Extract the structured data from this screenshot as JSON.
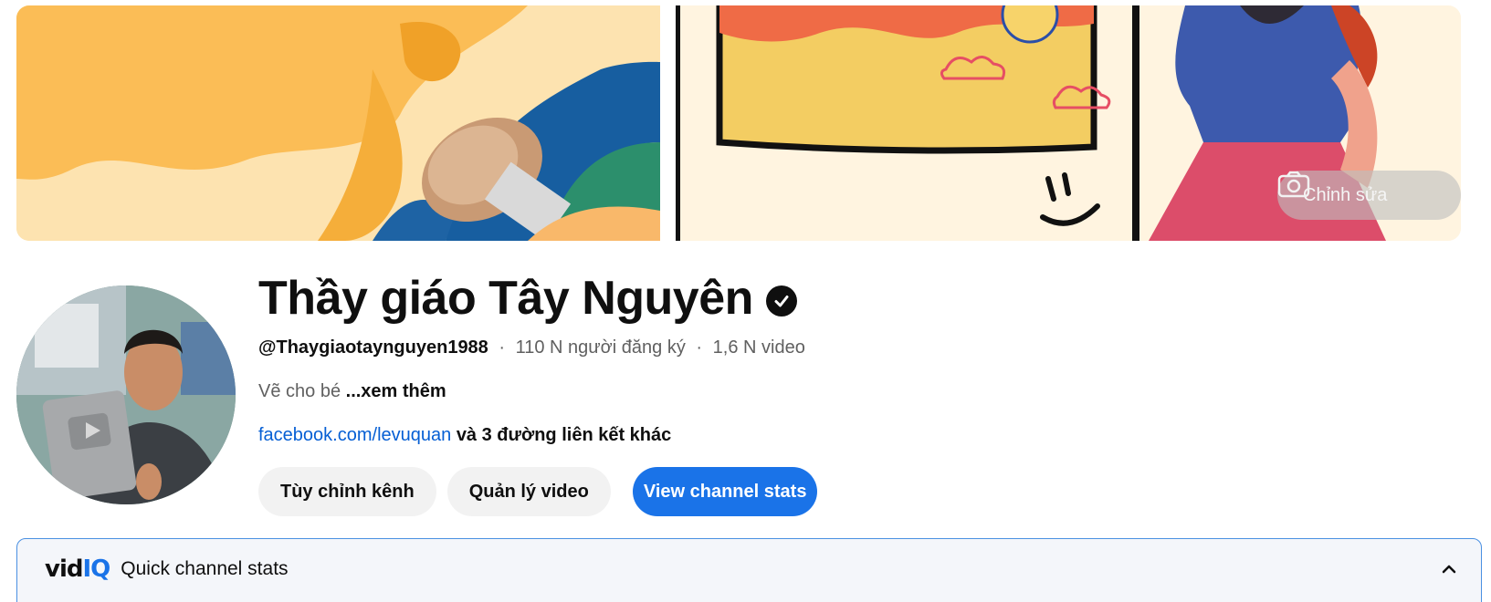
{
  "banner": {
    "edit_label": "Chỉnh sửa"
  },
  "channel": {
    "name": "Thầy giáo Tây Nguyên",
    "handle": "@Thaygiaotaynguyen1988",
    "subscribers": "110 N người đăng ký",
    "videos": "1,6 N video",
    "separator": "·",
    "description": "Vẽ cho bé",
    "more_label": "...xem thêm",
    "link": "facebook.com/levuquan",
    "other_links": "và 3 đường liên kết khác"
  },
  "actions": {
    "customize_label": "Tùy chỉnh kênh",
    "manage_label": "Quản lý video",
    "stats_label": "View channel stats"
  },
  "vidiq": {
    "logo_vid": "vid",
    "logo_iq": "IQ",
    "title": "Quick channel stats"
  },
  "icons": {
    "verified": "checkmark-badge-icon",
    "camera": "camera-icon",
    "collapse": "chevron-up-icon"
  },
  "colors": {
    "primary": "#1a73e8",
    "link": "#065fd4",
    "panel_border": "#4a90e2"
  }
}
